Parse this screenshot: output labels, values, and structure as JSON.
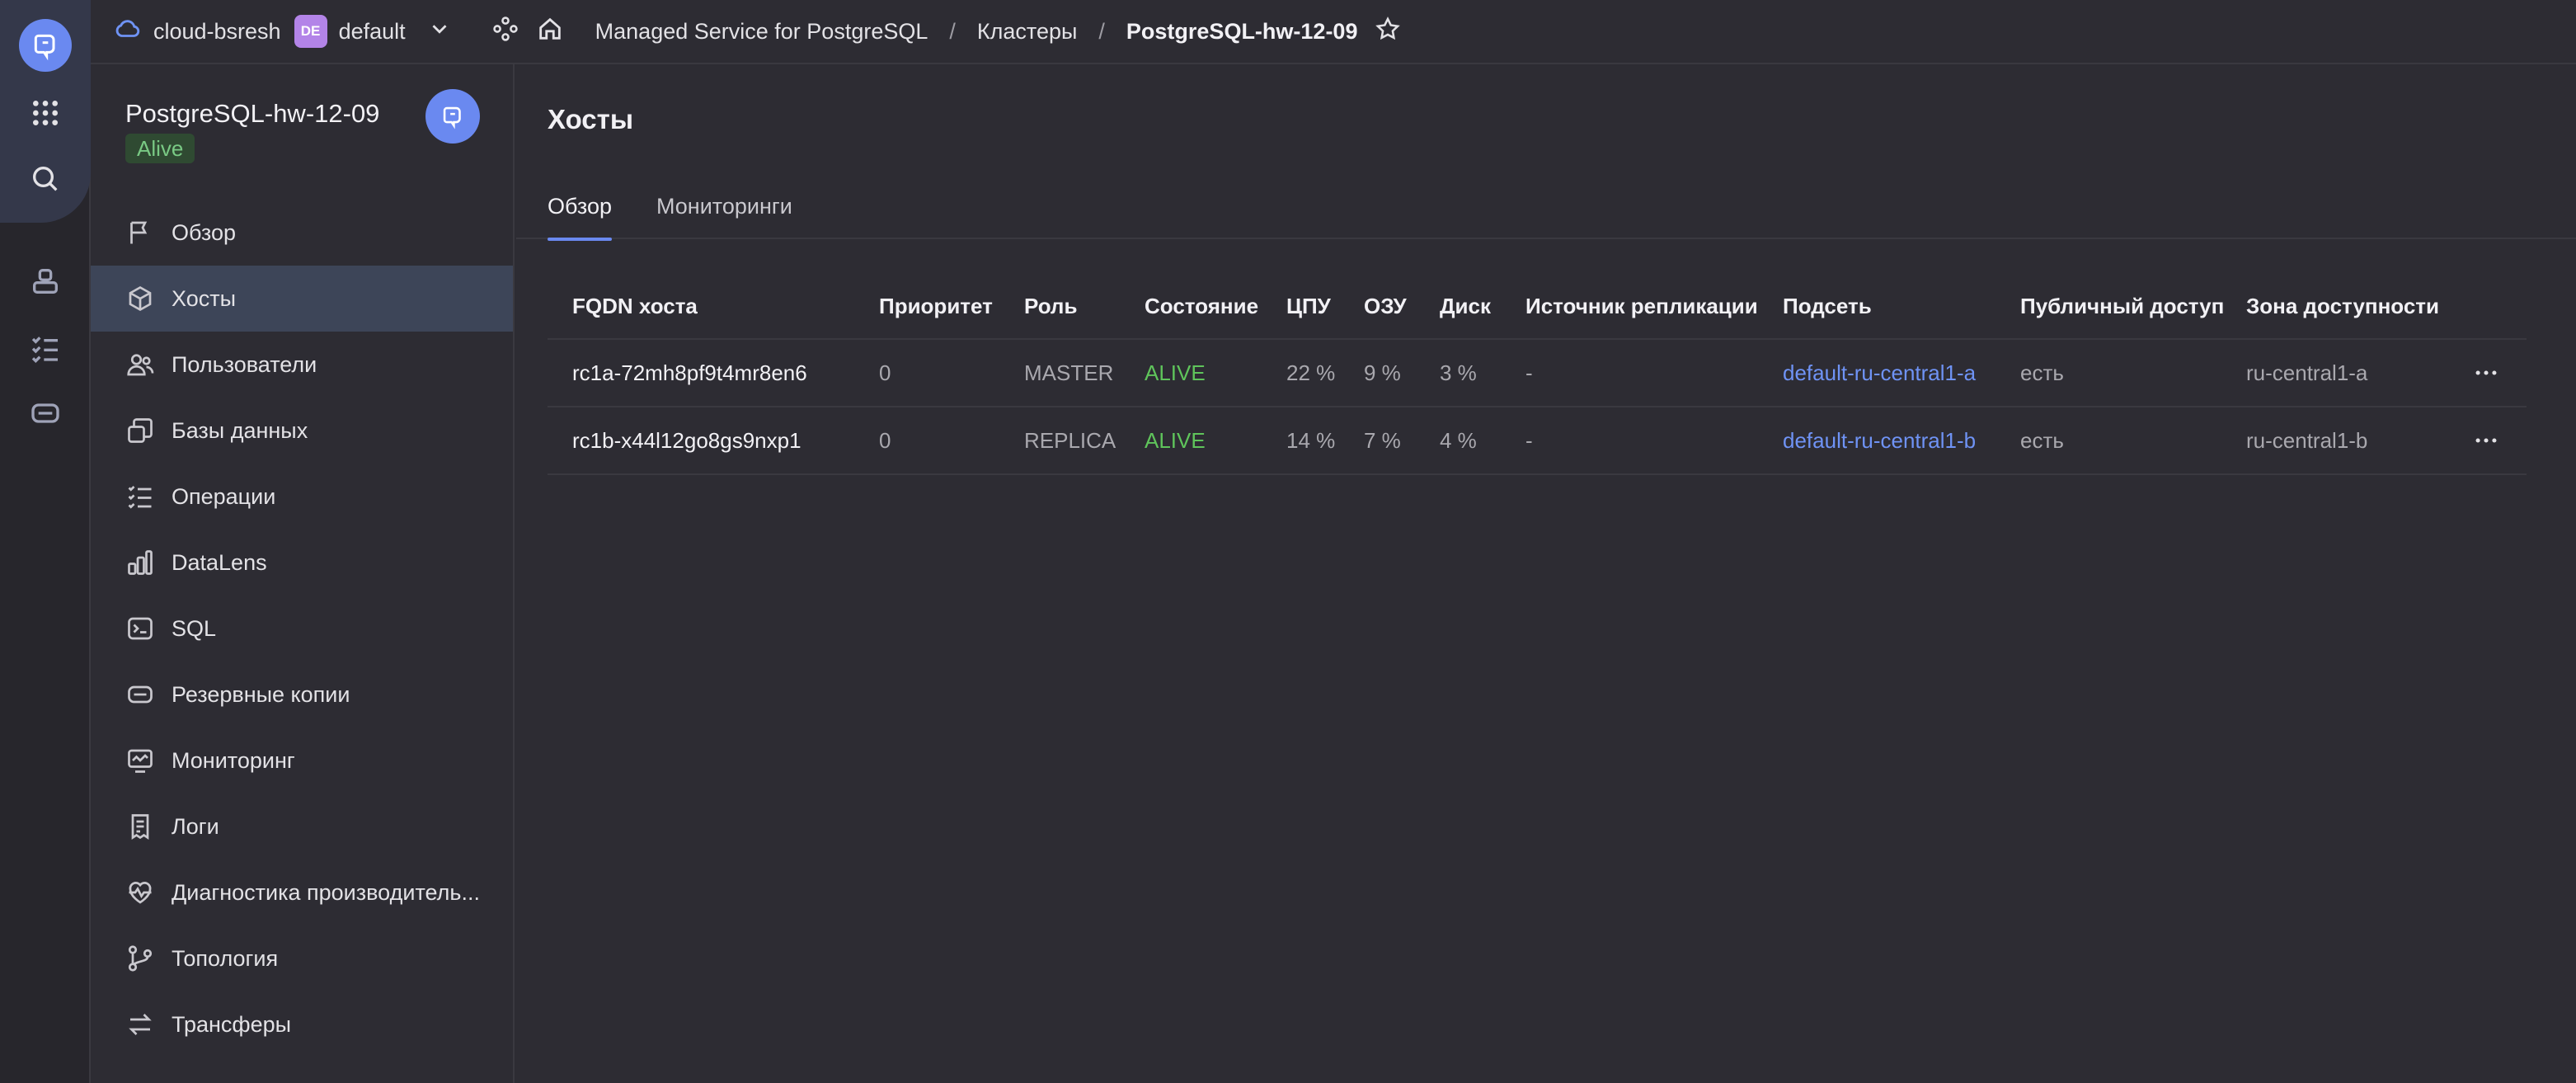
{
  "topbar": {
    "cloud_name": "cloud-bsresh",
    "folder_badge": "DE",
    "folder_name": "default",
    "breadcrumbs": [
      "Managed Service for PostgreSQL",
      "Кластеры",
      "PostgreSQL-hw-12-09"
    ],
    "separator": "/"
  },
  "sidebar": {
    "cluster_name": "PostgreSQL-hw-12-09",
    "status": "Alive",
    "items": [
      {
        "label": "Обзор",
        "icon": "flag-icon"
      },
      {
        "label": "Хосты",
        "icon": "cube-icon",
        "active": true
      },
      {
        "label": "Пользователи",
        "icon": "users-icon"
      },
      {
        "label": "Базы данных",
        "icon": "databases-icon"
      },
      {
        "label": "Операции",
        "icon": "list-check-icon"
      },
      {
        "label": "DataLens",
        "icon": "chart-icon"
      },
      {
        "label": "SQL",
        "icon": "terminal-icon"
      },
      {
        "label": "Резервные копии",
        "icon": "backup-icon"
      },
      {
        "label": "Мониторинг",
        "icon": "monitor-icon"
      },
      {
        "label": "Логи",
        "icon": "logs-icon"
      },
      {
        "label": "Диагностика производитель...",
        "icon": "heart-pulse-icon"
      },
      {
        "label": "Топология",
        "icon": "branch-icon"
      },
      {
        "label": "Трансферы",
        "icon": "arrows-icon"
      }
    ]
  },
  "main": {
    "title": "Хосты",
    "tabs": [
      {
        "label": "Обзор",
        "active": true
      },
      {
        "label": "Мониторинги",
        "active": false
      }
    ],
    "table": {
      "headers": {
        "fqdn": "FQDN хоста",
        "priority": "Приоритет",
        "role": "Роль",
        "state": "Состояние",
        "cpu": "ЦПУ",
        "ram": "ОЗУ",
        "disk": "Диск",
        "replication_source": "Источник репликации",
        "subnet": "Подсеть",
        "public_access": "Публичный доступ",
        "zone": "Зона доступности"
      },
      "rows": [
        {
          "fqdn": "rc1a-72mh8pf9t4mr8en6",
          "priority": "0",
          "role": "MASTER",
          "state": "ALIVE",
          "cpu": "22 %",
          "ram": "9 %",
          "disk": "3 %",
          "replication_source": "-",
          "subnet": "default-ru-central1-a",
          "public_access": "есть",
          "zone": "ru-central1-a"
        },
        {
          "fqdn": "rc1b-x44l12go8gs9nxp1",
          "priority": "0",
          "role": "REPLICA",
          "state": "ALIVE",
          "cpu": "14 %",
          "ram": "7 %",
          "disk": "4 %",
          "replication_source": "-",
          "subnet": "default-ru-central1-b",
          "public_access": "есть",
          "zone": "ru-central1-b"
        }
      ]
    }
  },
  "colors": {
    "accent": "#6a89f0",
    "alive": "#5fc45b",
    "link": "#6f93f5",
    "active_nav": "#3d4558",
    "folder_badge": "#b384e8"
  }
}
